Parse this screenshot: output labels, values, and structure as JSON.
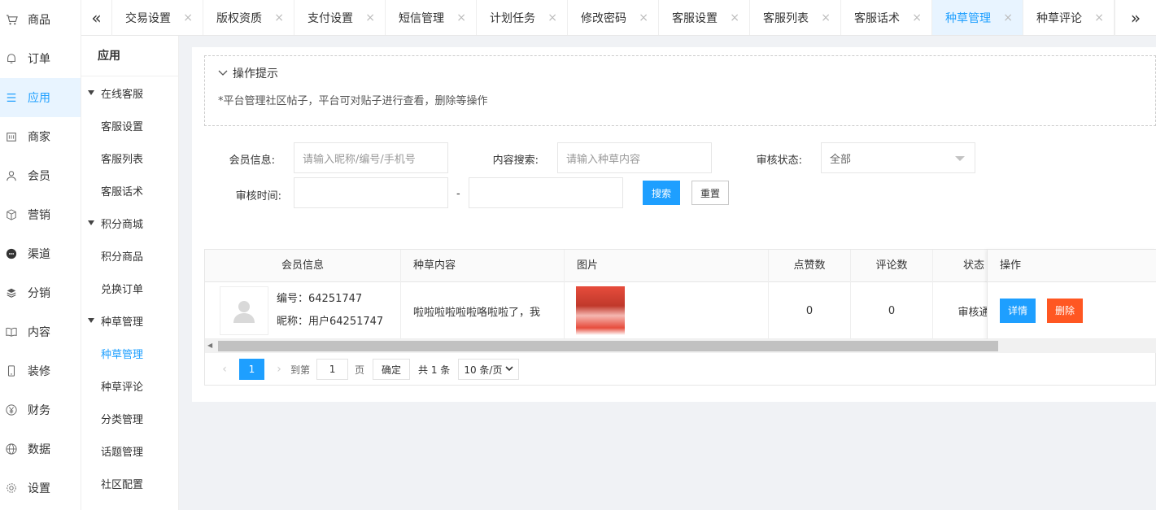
{
  "main_nav": [
    {
      "label": "商品",
      "icon": "cart-icon"
    },
    {
      "label": "订单",
      "icon": "bell-icon"
    },
    {
      "label": "应用",
      "icon": "list-icon",
      "active": true
    },
    {
      "label": "商家",
      "icon": "store-icon"
    },
    {
      "label": "会员",
      "icon": "user-icon"
    },
    {
      "label": "营销",
      "icon": "box-icon"
    },
    {
      "label": "渠道",
      "icon": "chat-icon"
    },
    {
      "label": "分销",
      "icon": "layers-icon"
    },
    {
      "label": "内容",
      "icon": "book-icon"
    },
    {
      "label": "装修",
      "icon": "phone-icon"
    },
    {
      "label": "财务",
      "icon": "yen-icon"
    },
    {
      "label": "数据",
      "icon": "globe-icon"
    },
    {
      "label": "设置",
      "icon": "gear-icon"
    }
  ],
  "sub_nav": {
    "title": "应用",
    "groups": [
      {
        "label": "在线客服",
        "links": [
          "客服设置",
          "客服列表",
          "客服话术"
        ]
      },
      {
        "label": "积分商城",
        "links": [
          "积分商品",
          "兑换订单"
        ]
      },
      {
        "label": "种草管理",
        "links": [
          "种草管理",
          "种草评论",
          "分类管理",
          "话题管理",
          "社区配置"
        ]
      }
    ],
    "active_link": "种草管理"
  },
  "tabs": [
    "交易设置",
    "版权资质",
    "支付设置",
    "短信管理",
    "计划任务",
    "修改密码",
    "客服设置",
    "客服列表",
    "客服话术",
    "种草管理",
    "种草评论"
  ],
  "active_tab": "种草管理",
  "tabbar": {
    "left_arrow": "«",
    "right_arrow": "»",
    "close_glyph": "×"
  },
  "tips": {
    "title": "操作提示",
    "text": "*平台管理社区帖子，平台可对贴子进行查看，删除等操作"
  },
  "form": {
    "member_label": "会员信息:",
    "member_placeholder": "请输入昵称/编号/手机号",
    "content_label": "内容搜索:",
    "content_placeholder": "请输入种草内容",
    "status_label": "审核状态:",
    "status_value": "全部",
    "time_label": "审核时间:",
    "time_separator": "-",
    "search_button": "搜索",
    "reset_button": "重置"
  },
  "table": {
    "columns": [
      "会员信息",
      "种草内容",
      "图片",
      "点赞数",
      "评论数",
      "状态",
      "操作"
    ],
    "rows": [
      {
        "member_id": "编号：64251747",
        "nickname": "昵称：用户64251747",
        "content": "啦啦啦啦啦啦咯啦啦了，我",
        "likes": "0",
        "comments": "0",
        "status": "审核通"
      }
    ],
    "detail_button": "详情",
    "delete_button": "删除"
  },
  "pager": {
    "current_page": "1",
    "goto_label": "到第",
    "goto_value": "1",
    "page_unit": "页",
    "confirm": "确定",
    "total": "共 1 条",
    "limit": "10 条/页"
  },
  "colors": {
    "accent": "#1e9fff",
    "danger": "#ff5722",
    "active_bg": "#e8f4ff"
  }
}
